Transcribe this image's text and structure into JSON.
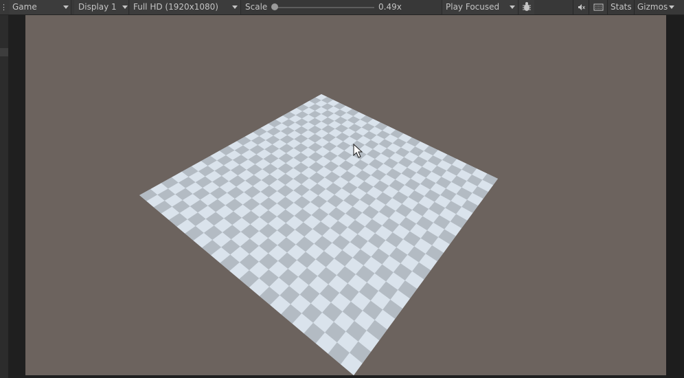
{
  "toolbar": {
    "view_tab": "Game",
    "display": "Display 1",
    "resolution": "Full HD (1920x1080)",
    "scale_label": "Scale",
    "scale_value": "0.49x",
    "scale_fraction": 0.0,
    "play_mode": "Play Focused",
    "debug_icon": "bug-icon",
    "mute_icon": "audio-mute-icon",
    "keyboard_icon": "keyboard-icon",
    "stats_label": "Stats",
    "gizmos_label": "Gizmos"
  },
  "colors": {
    "toolbar_bg": "#383838",
    "sky": "#6c635e",
    "checker_light": "#dae3ec",
    "checker_dark": "#b3bbc3"
  }
}
